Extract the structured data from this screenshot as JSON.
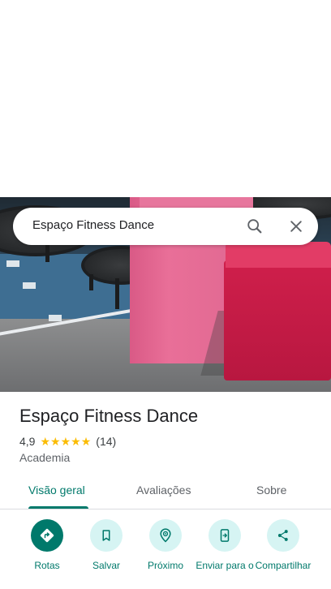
{
  "search": {
    "query": "Espaço Fitness Dance",
    "icons": [
      "search-icon",
      "close-icon"
    ]
  },
  "place": {
    "name": "Espaço Fitness Dance",
    "rating": "4,9",
    "stars": 5,
    "review_count": "(14)",
    "category": "Academia"
  },
  "tabs": [
    {
      "label": "Visão geral",
      "active": true
    },
    {
      "label": "Avaliações",
      "active": false
    },
    {
      "label": "Sobre",
      "active": false
    }
  ],
  "actions": [
    {
      "label": "Rotas",
      "icon": "directions-icon"
    },
    {
      "label": "Salvar",
      "icon": "bookmark-icon"
    },
    {
      "label": "Próximo",
      "icon": "nearby-icon"
    },
    {
      "label": "Enviar para o",
      "icon": "send-to-phone-icon"
    },
    {
      "label": "Compartilhar",
      "icon": "share-icon"
    }
  ],
  "colors": {
    "accent": "#00796b",
    "action_bg": "#d6f4f3",
    "star": "#fbbc04"
  }
}
